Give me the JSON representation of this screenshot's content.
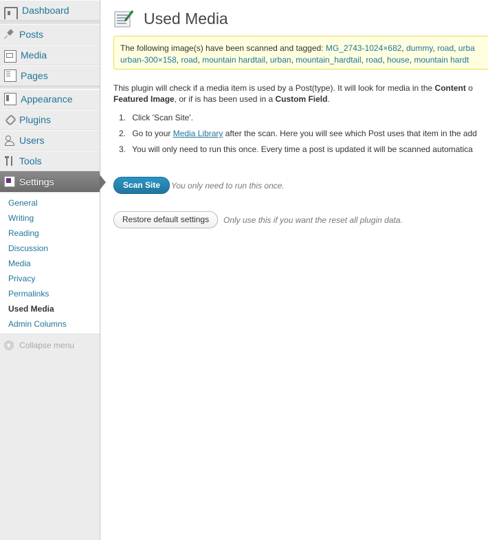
{
  "sidebar": {
    "items": [
      {
        "label": "Dashboard",
        "icon": "dashboard-icon"
      },
      {
        "label": "Posts",
        "icon": "pushpin-icon"
      },
      {
        "label": "Media",
        "icon": "media-icon"
      },
      {
        "label": "Pages",
        "icon": "pages-icon"
      },
      {
        "label": "Appearance",
        "icon": "appearance-icon"
      },
      {
        "label": "Plugins",
        "icon": "plugin-icon"
      },
      {
        "label": "Users",
        "icon": "users-icon"
      },
      {
        "label": "Tools",
        "icon": "tools-icon"
      },
      {
        "label": "Settings",
        "icon": "settings-icon"
      }
    ],
    "submenu": [
      "General",
      "Writing",
      "Reading",
      "Discussion",
      "Media",
      "Privacy",
      "Permalinks",
      "Used Media",
      "Admin Columns"
    ],
    "collapse_label": "Collapse menu"
  },
  "page": {
    "title": "Used Media",
    "icon": "media-plugin-icon"
  },
  "notice": {
    "prefix": "The following image(s) have been scanned and tagged: ",
    "line1_tags": [
      "MG_2743-1024×682",
      "dummy",
      "road",
      "urba"
    ],
    "line2_tags": [
      "urban-300×158",
      "road",
      "mountain hardtail",
      "urban",
      "mountain_hardtail",
      "road",
      "house",
      "mountain hardt"
    ]
  },
  "description": {
    "part1": "This plugin will check if a media item is used by a Post(type). It will look for media in the ",
    "bold1": "Content",
    "part2": " o",
    "bold2": "Featured Image",
    "part3": ", or if is has been used in a ",
    "bold3": "Custom Field",
    "part4": "."
  },
  "steps": [
    {
      "num": "1.",
      "text": "Click 'Scan Site'."
    },
    {
      "num": "2.",
      "pre": "Go to your ",
      "link": "Media Library",
      "post": " after the scan. Here you will see which Post uses that item in the add"
    },
    {
      "num": "3.",
      "text": "You will only need to run this once. Every time a post is updated it will be scanned automatica"
    }
  ],
  "scan": {
    "button_label": "Scan Site",
    "note": "You only need to run this once."
  },
  "restore": {
    "button_label": "Restore default settings",
    "note": "Only use this if you want the reset all plugin data."
  },
  "colors": {
    "link": "#21759b",
    "notice_bg": "#ffffe0",
    "notice_border": "#e6db55",
    "primary_button": "#21759b"
  }
}
